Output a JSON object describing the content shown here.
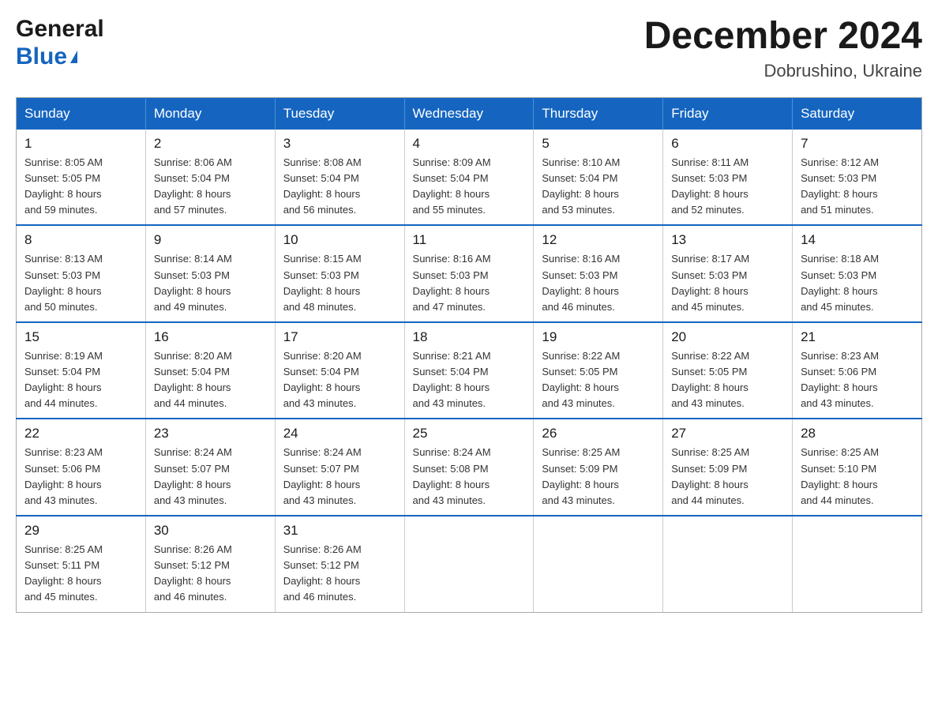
{
  "header": {
    "logo_general": "General",
    "logo_blue": "Blue",
    "main_title": "December 2024",
    "subtitle": "Dobrushino, Ukraine"
  },
  "days_of_week": [
    "Sunday",
    "Monday",
    "Tuesday",
    "Wednesday",
    "Thursday",
    "Friday",
    "Saturday"
  ],
  "weeks": [
    [
      {
        "day": "1",
        "sunrise": "8:05 AM",
        "sunset": "5:05 PM",
        "daylight": "8 hours and 59 minutes."
      },
      {
        "day": "2",
        "sunrise": "8:06 AM",
        "sunset": "5:04 PM",
        "daylight": "8 hours and 57 minutes."
      },
      {
        "day": "3",
        "sunrise": "8:08 AM",
        "sunset": "5:04 PM",
        "daylight": "8 hours and 56 minutes."
      },
      {
        "day": "4",
        "sunrise": "8:09 AM",
        "sunset": "5:04 PM",
        "daylight": "8 hours and 55 minutes."
      },
      {
        "day": "5",
        "sunrise": "8:10 AM",
        "sunset": "5:04 PM",
        "daylight": "8 hours and 53 minutes."
      },
      {
        "day": "6",
        "sunrise": "8:11 AM",
        "sunset": "5:03 PM",
        "daylight": "8 hours and 52 minutes."
      },
      {
        "day": "7",
        "sunrise": "8:12 AM",
        "sunset": "5:03 PM",
        "daylight": "8 hours and 51 minutes."
      }
    ],
    [
      {
        "day": "8",
        "sunrise": "8:13 AM",
        "sunset": "5:03 PM",
        "daylight": "8 hours and 50 minutes."
      },
      {
        "day": "9",
        "sunrise": "8:14 AM",
        "sunset": "5:03 PM",
        "daylight": "8 hours and 49 minutes."
      },
      {
        "day": "10",
        "sunrise": "8:15 AM",
        "sunset": "5:03 PM",
        "daylight": "8 hours and 48 minutes."
      },
      {
        "day": "11",
        "sunrise": "8:16 AM",
        "sunset": "5:03 PM",
        "daylight": "8 hours and 47 minutes."
      },
      {
        "day": "12",
        "sunrise": "8:16 AM",
        "sunset": "5:03 PM",
        "daylight": "8 hours and 46 minutes."
      },
      {
        "day": "13",
        "sunrise": "8:17 AM",
        "sunset": "5:03 PM",
        "daylight": "8 hours and 45 minutes."
      },
      {
        "day": "14",
        "sunrise": "8:18 AM",
        "sunset": "5:03 PM",
        "daylight": "8 hours and 45 minutes."
      }
    ],
    [
      {
        "day": "15",
        "sunrise": "8:19 AM",
        "sunset": "5:04 PM",
        "daylight": "8 hours and 44 minutes."
      },
      {
        "day": "16",
        "sunrise": "8:20 AM",
        "sunset": "5:04 PM",
        "daylight": "8 hours and 44 minutes."
      },
      {
        "day": "17",
        "sunrise": "8:20 AM",
        "sunset": "5:04 PM",
        "daylight": "8 hours and 43 minutes."
      },
      {
        "day": "18",
        "sunrise": "8:21 AM",
        "sunset": "5:04 PM",
        "daylight": "8 hours and 43 minutes."
      },
      {
        "day": "19",
        "sunrise": "8:22 AM",
        "sunset": "5:05 PM",
        "daylight": "8 hours and 43 minutes."
      },
      {
        "day": "20",
        "sunrise": "8:22 AM",
        "sunset": "5:05 PM",
        "daylight": "8 hours and 43 minutes."
      },
      {
        "day": "21",
        "sunrise": "8:23 AM",
        "sunset": "5:06 PM",
        "daylight": "8 hours and 43 minutes."
      }
    ],
    [
      {
        "day": "22",
        "sunrise": "8:23 AM",
        "sunset": "5:06 PM",
        "daylight": "8 hours and 43 minutes."
      },
      {
        "day": "23",
        "sunrise": "8:24 AM",
        "sunset": "5:07 PM",
        "daylight": "8 hours and 43 minutes."
      },
      {
        "day": "24",
        "sunrise": "8:24 AM",
        "sunset": "5:07 PM",
        "daylight": "8 hours and 43 minutes."
      },
      {
        "day": "25",
        "sunrise": "8:24 AM",
        "sunset": "5:08 PM",
        "daylight": "8 hours and 43 minutes."
      },
      {
        "day": "26",
        "sunrise": "8:25 AM",
        "sunset": "5:09 PM",
        "daylight": "8 hours and 43 minutes."
      },
      {
        "day": "27",
        "sunrise": "8:25 AM",
        "sunset": "5:09 PM",
        "daylight": "8 hours and 44 minutes."
      },
      {
        "day": "28",
        "sunrise": "8:25 AM",
        "sunset": "5:10 PM",
        "daylight": "8 hours and 44 minutes."
      }
    ],
    [
      {
        "day": "29",
        "sunrise": "8:25 AM",
        "sunset": "5:11 PM",
        "daylight": "8 hours and 45 minutes."
      },
      {
        "day": "30",
        "sunrise": "8:26 AM",
        "sunset": "5:12 PM",
        "daylight": "8 hours and 46 minutes."
      },
      {
        "day": "31",
        "sunrise": "8:26 AM",
        "sunset": "5:12 PM",
        "daylight": "8 hours and 46 minutes."
      },
      null,
      null,
      null,
      null
    ]
  ]
}
